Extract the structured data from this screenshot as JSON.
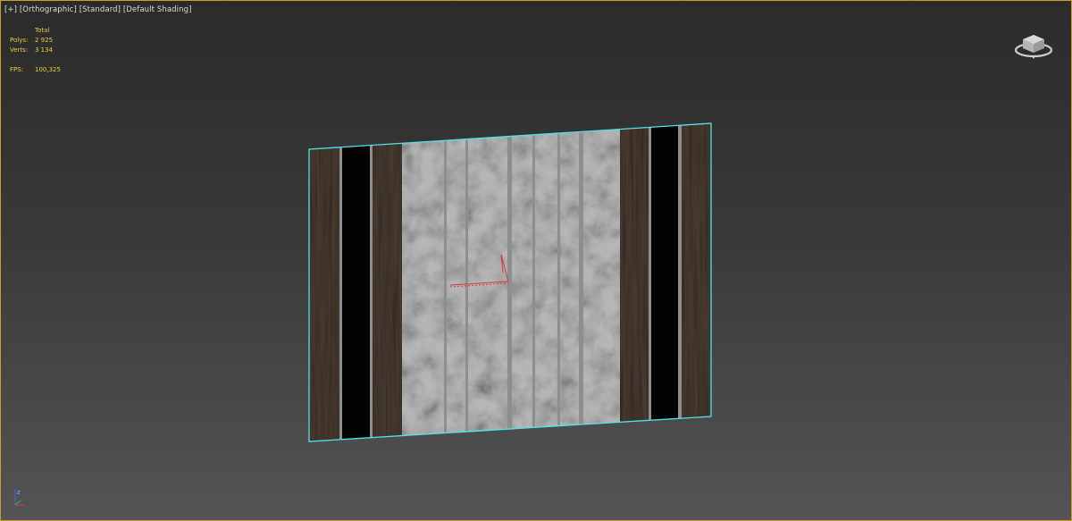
{
  "viewport": {
    "label_parts": [
      "[+]",
      "[Orthographic]",
      "[Standard]",
      "[Default Shading]"
    ]
  },
  "stats": {
    "header": "Total",
    "rows": [
      {
        "label": "Polys:",
        "value": "2 925"
      },
      {
        "label": "Verts:",
        "value": "3 134"
      }
    ],
    "fps_label": "FPS:",
    "fps_value": "100,325"
  },
  "axis": {
    "z_label": "z"
  },
  "colors": {
    "selection": "#4fe4ea",
    "wood": "#4a3c32",
    "glass": "#030303",
    "stone": "#b6b6b6",
    "metal": "#8e8e8e",
    "label": "#dcdcdc",
    "stats": "#e8d040",
    "border": "#c8a030"
  },
  "icons": {
    "viewcube": "viewcube-icon",
    "gizmo": "transform-gizmo-icon",
    "tripod": "axis-tripod-icon"
  }
}
